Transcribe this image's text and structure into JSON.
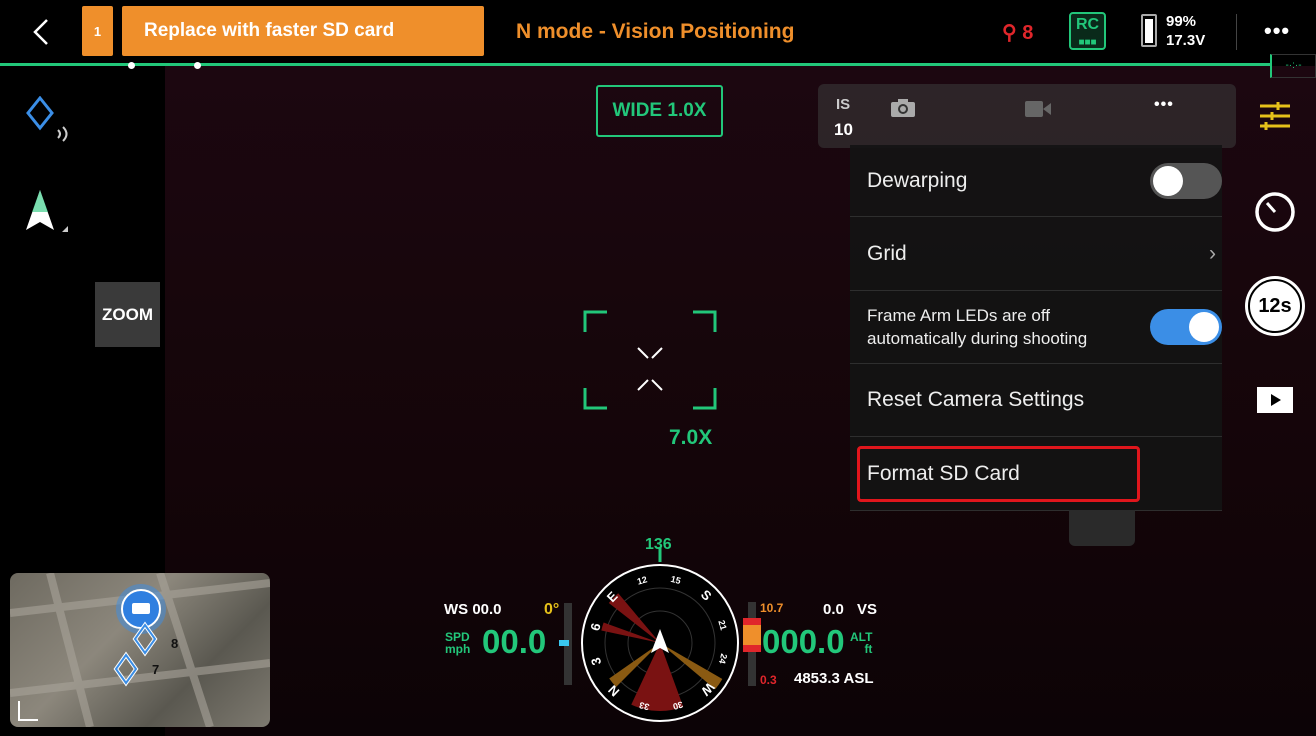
{
  "topbar": {
    "back_icon": "chevron-left-icon",
    "warning_count": "1",
    "warning_message": "Replace with faster SD card",
    "flight_mode": "N mode - Vision Positioning",
    "satellite_count": "8",
    "rc_label": "RC",
    "battery_percent": "99%",
    "battery_voltage": "17.3V",
    "more_label": "•••"
  },
  "left": {
    "zoom_label": "ZOOM"
  },
  "lens": {
    "label": "WIDE 1.0X",
    "zoom_value": "7.0X"
  },
  "camera_bar": {
    "iso_label": "IS",
    "iso_value": "10",
    "more_label": "•••"
  },
  "menu": {
    "items": [
      {
        "label": "Dewarping",
        "control": "toggle",
        "on": false
      },
      {
        "label": "Grid",
        "control": "chevron"
      },
      {
        "label": "Frame Arm LEDs are off automatically during shooting",
        "control": "toggle",
        "on": true
      },
      {
        "label": "Reset Camera Settings"
      },
      {
        "label": "Format SD Card",
        "highlighted": true
      }
    ]
  },
  "right": {
    "timer_label": "12s"
  },
  "telemetry": {
    "heading": "136",
    "ws": "WS 00.0",
    "gimbal": "0°",
    "spd_label": "SPD",
    "spd_unit": "mph",
    "speed": "00.0",
    "alt_top": "10.7",
    "vs_value": "0.0",
    "vs_label": "VS",
    "altitude": "000.0",
    "alt_label": "ALT",
    "alt_unit": "ft",
    "alt_bottom": "0.3",
    "asl": "4853.3 ASL",
    "compass_labels": [
      "12",
      "15",
      "S",
      "21",
      "24",
      "W",
      "30",
      "33",
      "N",
      "3",
      "6",
      "E"
    ]
  },
  "map": {
    "labels": [
      "8",
      "7"
    ]
  },
  "colors": {
    "accent": "#22c77a",
    "warning": "#ef8f2b",
    "danger": "#e0262b",
    "highlight": "#e0161c"
  }
}
